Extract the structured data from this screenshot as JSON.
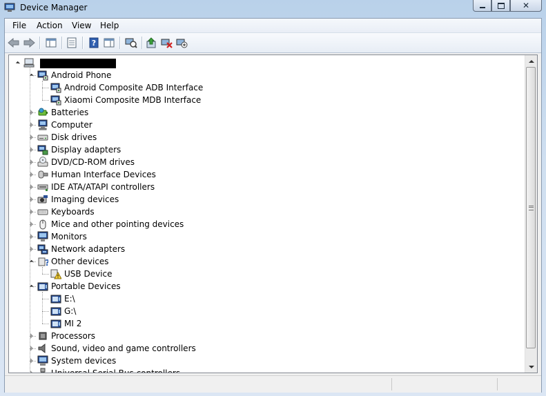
{
  "window": {
    "title": "Device Manager",
    "app_icon": "device-manager-icon",
    "caption_buttons": [
      "minimize",
      "maximize",
      "close"
    ]
  },
  "menu": [
    "File",
    "Action",
    "View",
    "Help"
  ],
  "toolbar": [
    "back-arrow-icon",
    "forward-arrow-icon",
    "show-hide-console-tree-icon",
    "properties-icon",
    "help-icon",
    "show-action-pane-icon",
    "scan-hardware-changes-icon",
    "update-driver-icon",
    "uninstall-icon",
    "disable-device-icon"
  ],
  "tree": {
    "root_label": "",
    "nodes": [
      {
        "label": "Android Phone",
        "icon": "android-phone-icon",
        "expanded": true,
        "children": [
          {
            "label": "Android Composite ADB Interface",
            "icon": "usb-interface-icon"
          },
          {
            "label": "Xiaomi Composite MDB Interface",
            "icon": "usb-interface-icon"
          }
        ]
      },
      {
        "label": "Batteries",
        "icon": "battery-icon",
        "expanded": false
      },
      {
        "label": "Computer",
        "icon": "computer-icon",
        "expanded": false
      },
      {
        "label": "Disk drives",
        "icon": "disk-drive-icon",
        "expanded": false
      },
      {
        "label": "Display adapters",
        "icon": "display-adapter-icon",
        "expanded": false
      },
      {
        "label": "DVD/CD-ROM drives",
        "icon": "dvd-drive-icon",
        "expanded": false
      },
      {
        "label": "Human Interface Devices",
        "icon": "hid-icon",
        "expanded": false
      },
      {
        "label": "IDE ATA/ATAPI controllers",
        "icon": "ide-controller-icon",
        "expanded": false
      },
      {
        "label": "Imaging devices",
        "icon": "camera-icon",
        "expanded": false
      },
      {
        "label": "Keyboards",
        "icon": "keyboard-icon",
        "expanded": false
      },
      {
        "label": "Mice and other pointing devices",
        "icon": "mouse-icon",
        "expanded": false
      },
      {
        "label": "Monitors",
        "icon": "monitor-icon",
        "expanded": false
      },
      {
        "label": "Network adapters",
        "icon": "network-adapter-icon",
        "expanded": false
      },
      {
        "label": "Other devices",
        "icon": "unknown-device-icon",
        "expanded": true,
        "children": [
          {
            "label": "USB Device",
            "icon": "warning-device-icon"
          }
        ]
      },
      {
        "label": "Portable Devices",
        "icon": "portable-device-icon",
        "expanded": true,
        "children": [
          {
            "label": "E:\\",
            "icon": "portable-drive-icon"
          },
          {
            "label": "G:\\",
            "icon": "portable-drive-icon"
          },
          {
            "label": "MI 2",
            "icon": "portable-drive-icon"
          }
        ]
      },
      {
        "label": "Processors",
        "icon": "processor-icon",
        "expanded": false
      },
      {
        "label": "Sound, video and game controllers",
        "icon": "speaker-icon",
        "expanded": false
      },
      {
        "label": "System devices",
        "icon": "system-device-icon",
        "expanded": false
      },
      {
        "label": "Universal Serial Bus controllers",
        "icon": "usb-icon",
        "expanded": false
      }
    ]
  },
  "status": [
    "",
    "",
    ""
  ]
}
